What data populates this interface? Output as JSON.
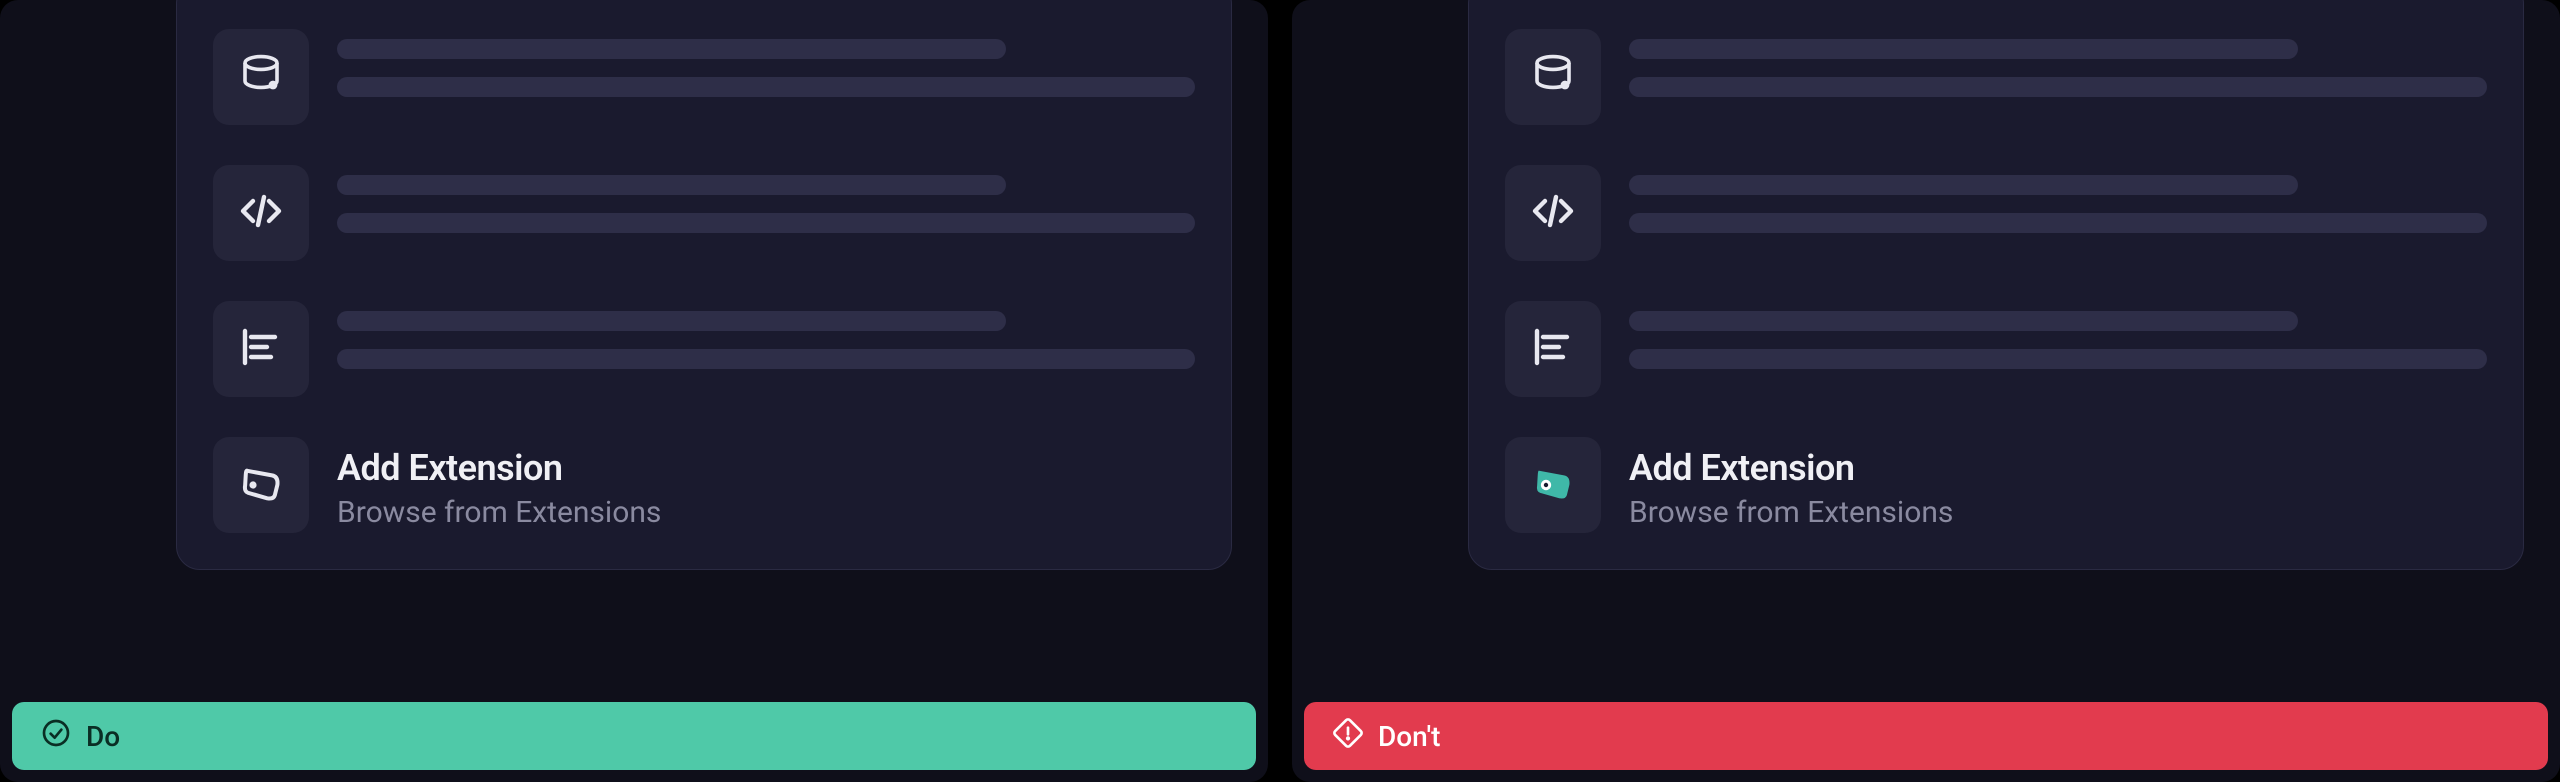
{
  "examples": {
    "do": {
      "status_label": "Do",
      "add_extension": {
        "title": "Add Extension",
        "subtitle": "Browse from Extensions"
      }
    },
    "dont": {
      "status_label": "Don't",
      "add_extension": {
        "title": "Add Extension",
        "subtitle": "Browse from Extensions"
      }
    }
  }
}
